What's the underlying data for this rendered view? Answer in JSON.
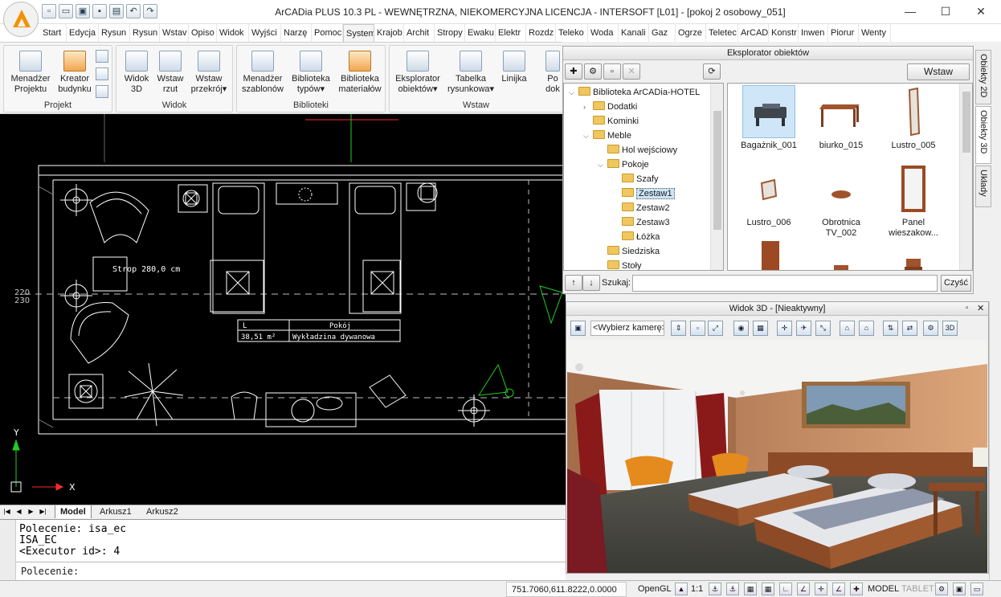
{
  "window": {
    "title": "ArCADia PLUS 10.3 PL - WEWNĘTRZNA, NIEKOMERCYJNA LICENCJA - INTERSOFT [L01] - [pokoj 2 osobowy_051]"
  },
  "tabs": [
    "Start",
    "Edycja",
    "Rysun",
    "Rysun",
    "Wstav",
    "Opiso",
    "Widok",
    "Wyjści",
    "Narzę",
    "Pomoc",
    "System",
    "Krajob",
    "Archit",
    "Stropy",
    "Ewaku",
    "Elektr",
    "Rozdz",
    "Teleko",
    "Woda",
    "Kanali",
    "Gaz",
    "Ogrze",
    "Teletec",
    "ArCAD",
    "Konstr",
    "Inwen",
    "Piorur",
    "Wenty"
  ],
  "ribbon": {
    "projekt": {
      "label": "Projekt",
      "btn1": "Menadżer\nProjektu",
      "btn2": "Kreator\nbudynku"
    },
    "widok": {
      "label": "Widok",
      "btn1": "Widok\n3D",
      "btn2": "Wstaw\nrzut",
      "btn3": "Wstaw\nprzekrój▾"
    },
    "biblioteki": {
      "label": "Biblioteki",
      "btn1": "Menadżer\nszablonów",
      "btn2": "Biblioteka\ntypów▾",
      "btn3": "Biblioteka\nmateriałów"
    },
    "wstaw": {
      "label": "Wstaw",
      "btn1": "Eksplorator\nobiektów▾",
      "btn2": "Tabelka\nrysunkowa▾",
      "btn3": "Linijka",
      "btn4": "Po\ndok"
    }
  },
  "cad": {
    "strop": "Strop 280,0 cm",
    "pokoj_header": "Pokój",
    "area_header": "L",
    "area": "38,51 m²",
    "floor": "Wykładzina dywanowa",
    "dim1": "220",
    "dim2": "230",
    "axis_x": "X",
    "axis_y": "Y"
  },
  "sheets": {
    "model": "Model",
    "sheet1": "Arkusz1",
    "sheet2": "Arkusz2"
  },
  "command": {
    "line1": "Polecenie: isa_ec",
    "line2": "ISA_EC",
    "line3": "<Executor id>: 4",
    "prompt": "Polecenie:"
  },
  "status": {
    "coords": "751.7060,611.8222,0.0000",
    "opengl": "OpenGL",
    "scale": "1:1",
    "model": "MODEL",
    "tablet": "TABLET"
  },
  "explorer": {
    "title": "Eksplorator obiektów",
    "insert": "Wstaw",
    "search_label": "Szukaj:",
    "search_value": "",
    "clear": "Czyść",
    "tree": [
      {
        "label": "Biblioteka ArCADia-HOTEL",
        "depth": 0,
        "open": true
      },
      {
        "label": "Dodatki",
        "depth": 1,
        "open": false
      },
      {
        "label": "Kominki",
        "depth": 1,
        "open": null
      },
      {
        "label": "Meble",
        "depth": 1,
        "open": true
      },
      {
        "label": "Hol wejściowy",
        "depth": 2,
        "open": null
      },
      {
        "label": "Pokoje",
        "depth": 2,
        "open": true
      },
      {
        "label": "Szafy",
        "depth": 3,
        "open": null
      },
      {
        "label": "Zestaw1",
        "depth": 3,
        "open": null,
        "selected": true
      },
      {
        "label": "Zestaw2",
        "depth": 3,
        "open": null
      },
      {
        "label": "Zestaw3",
        "depth": 3,
        "open": null
      },
      {
        "label": "Łóżka",
        "depth": 3,
        "open": null
      },
      {
        "label": "Siedziska",
        "depth": 2,
        "open": null
      },
      {
        "label": "Stoły",
        "depth": 2,
        "open": null
      }
    ],
    "items": [
      {
        "label": "Bagażnik_001",
        "selected": true
      },
      {
        "label": "biurko_015"
      },
      {
        "label": "Lustro_005"
      },
      {
        "label": "Lustro_006"
      },
      {
        "label": "Obrotnica\nTV_002"
      },
      {
        "label": "Panel\nwieszakow..."
      }
    ]
  },
  "side_tabs": [
    "Obiekty 2D",
    "Obiekty 3D",
    "Układy"
  ],
  "view3d": {
    "title": "Widok 3D - [Nieaktywny]",
    "camera": "<Wybierz kamerę>"
  }
}
